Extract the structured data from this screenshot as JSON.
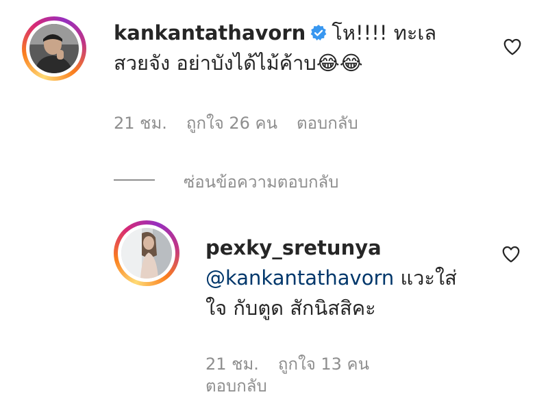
{
  "comment1": {
    "username": "kankantathavorn",
    "verified_icon": "verified-badge-icon",
    "text_line1": "โห!!!! ทะเล",
    "text_line2": "สวยจัง อย่าบังได้ไม้ค้าบ",
    "emoji": "😂😂",
    "time": "21 ชม.",
    "likes": "ถูกใจ 26 คน",
    "reply_label": "ตอบกลับ",
    "like_icon": "heart-outline-icon"
  },
  "hide_replies": "ซ่อนข้อความตอบกลับ",
  "comment2": {
    "username": "pexky_sretunya",
    "mention": "@kankantathavorn",
    "text_after_mention": " แวะใส่",
    "text_line2": "ใจ กับตูด สักนิสสิคะ",
    "time": "21 ชม.",
    "likes": "ถูกใจ 13 คน",
    "reply_label": "ตอบกลับ",
    "like_icon": "heart-outline-icon"
  },
  "colors": {
    "text": "#262626",
    "secondary": "#8e8e8e",
    "mention": "#00376b",
    "verified": "#3897f0"
  }
}
